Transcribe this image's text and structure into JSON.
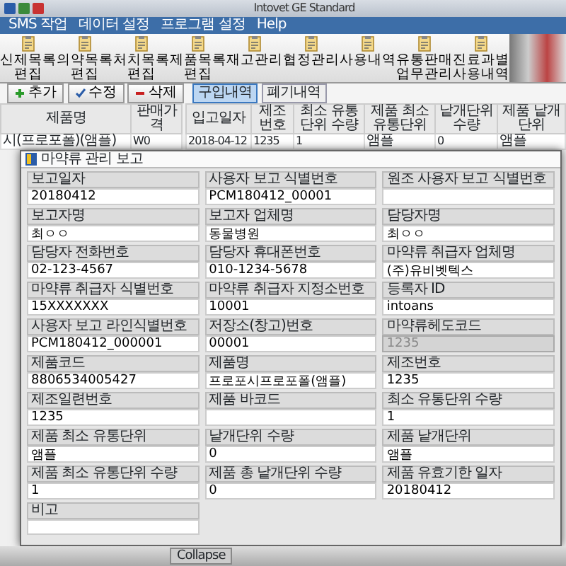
{
  "window": {
    "title": "Intovet GE Standard"
  },
  "menu": [
    {
      "label": "SMS 작업"
    },
    {
      "label": "데이터 설정"
    },
    {
      "label": "프로그램 설정"
    },
    {
      "label": "Help"
    }
  ],
  "toolbar": [
    {
      "label": "신제목록편집"
    },
    {
      "label": "의약목록편집"
    },
    {
      "label": "처치목록편집"
    },
    {
      "label": "제품목록편집"
    },
    {
      "label": "재고관리"
    },
    {
      "label": "협정관리"
    },
    {
      "label": "사용내역"
    },
    {
      "label": "유통판매 업무관리"
    },
    {
      "label": "진료과별 사용내역"
    }
  ],
  "buttons": [
    {
      "label": "추가",
      "kind": "add"
    },
    {
      "label": "수정",
      "kind": "edit"
    },
    {
      "label": "삭제",
      "kind": "delete"
    }
  ],
  "tabs": [
    {
      "label": "구입내역",
      "selected": true
    },
    {
      "label": "폐기내역",
      "selected": false
    }
  ],
  "product_table": {
    "columns": [
      "제품명",
      "판매가격"
    ],
    "rows": [
      [
        "시(프로포폴)(앰플)",
        "W0"
      ]
    ]
  },
  "stock_table": {
    "columns": [
      "입고일자",
      "제조번호",
      "최소 유통단위 수량",
      "제품 최소 유통단위",
      "낱개단위 수량",
      "제품 낱개단위"
    ],
    "rows": [
      [
        "2018-04-12",
        "1235",
        "1",
        "앰플",
        "0",
        "앰플"
      ]
    ]
  },
  "dialog": {
    "title": "마약류 관리 보고",
    "remark_label": "비고",
    "fields": [
      {
        "label": "보고일자",
        "value": "20180412",
        "disabled": false
      },
      {
        "label": "사용자 보고 식별번호",
        "value": "PCM180412_00001",
        "disabled": false
      },
      {
        "label": "원조 사용자 보고 식별번호",
        "disabled": false
      },
      {
        "label": "보고자명",
        "value": "최ㅇㅇ",
        "disabled": false
      },
      {
        "label": "보고자 업체명",
        "value": "동물병원",
        "disabled": false
      },
      {
        "label": "담당자명",
        "value": "최ㅇㅇ",
        "disabled": false
      },
      {
        "label": "담당자 전화번호",
        "value": "02-123-4567",
        "disabled": false
      },
      {
        "label": "담당자 휴대폰번호",
        "value": "010-1234-5678",
        "disabled": false
      },
      {
        "label": "마약류 취급자 업체명",
        "value": "(주)유비벳텍스",
        "disabled": false
      },
      {
        "label": "마약류 취급자 식별번호",
        "value": "15XXXXXXX",
        "disabled": false
      },
      {
        "label": "마약류 취급자 지정소번호",
        "value": "10001",
        "disabled": false
      },
      {
        "label": "등록자 ID",
        "value": "intoans",
        "disabled": false
      },
      {
        "label": "사용자 보고 라인식별번호",
        "value": "PCM180412_000001",
        "disabled": false
      },
      {
        "label": "저장소(창고)번호",
        "value": "00001",
        "disabled": false
      },
      {
        "label": "마약류헤도코드",
        "value": "1235",
        "disabled": true
      },
      {
        "label": "제품코드",
        "value": "8806534005427",
        "disabled": false
      },
      {
        "label": "제품명",
        "value": "프로포시프로포폴(앰플)",
        "disabled": false
      },
      {
        "label": "제조번호",
        "value": "1235",
        "disabled": false
      },
      {
        "label": "제조일련번호",
        "value": "1235",
        "disabled": false
      },
      {
        "label": "제품 바코드",
        "disabled": false
      },
      {
        "label": "최소 유통단위 수량",
        "value": "1",
        "disabled": false
      },
      {
        "label": "제품 최소 유통단위",
        "value": "앰플",
        "disabled": false
      },
      {
        "label": "낱개단위 수량",
        "value": "0",
        "disabled": false
      },
      {
        "label": "제품 낱개단위",
        "value": "앰플",
        "disabled": false
      },
      {
        "label": "제품 최소 유통단위 수량",
        "value": "1",
        "disabled": false
      },
      {
        "label": "제품 총 낱개단위 수량",
        "value": "0",
        "disabled": false
      },
      {
        "label": "제품 유효기한 일자",
        "value": "20180412",
        "disabled": false
      }
    ]
  },
  "bottom_tabs": [
    {
      "label": "Collapse"
    }
  ]
}
